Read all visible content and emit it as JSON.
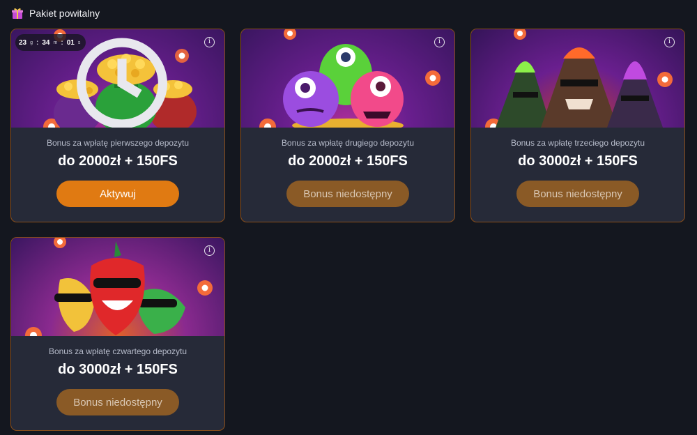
{
  "header": {
    "title": "Pakiet powitalny",
    "icon": "gift-icon"
  },
  "cards": [
    {
      "subtitle": "Bonus za wpłatę pierwszego depozytu",
      "amount": "do 2000zł + 150FS",
      "button": "Aktywuj",
      "button_state": "active",
      "art": "money-bags",
      "timer": {
        "days": "23",
        "days_unit": "g",
        "hours": "34",
        "hours_unit": "m",
        "seconds": "01",
        "seconds_unit": "s"
      }
    },
    {
      "subtitle": "Bonus za wpłatę drugiego depozytu",
      "amount": "do 2000zł + 150FS",
      "button": "Bonus niedostępny",
      "button_state": "disabled",
      "art": "monsters"
    },
    {
      "subtitle": "Bonus za wpłatę trzeciego depozytu",
      "amount": "do 3000zł + 150FS",
      "button": "Bonus niedostępny",
      "button_state": "disabled",
      "art": "volcanoes"
    },
    {
      "subtitle": "Bonus za wpłatę czwartego depozytu",
      "amount": "do 3000zł + 150FS",
      "button": "Bonus niedostępny",
      "button_state": "disabled",
      "art": "chili-peppers"
    }
  ],
  "colors": {
    "accent": "#e07a12",
    "disabled": "#8a5a26",
    "card_border": "#8a4e1a",
    "background": "#14171f"
  }
}
